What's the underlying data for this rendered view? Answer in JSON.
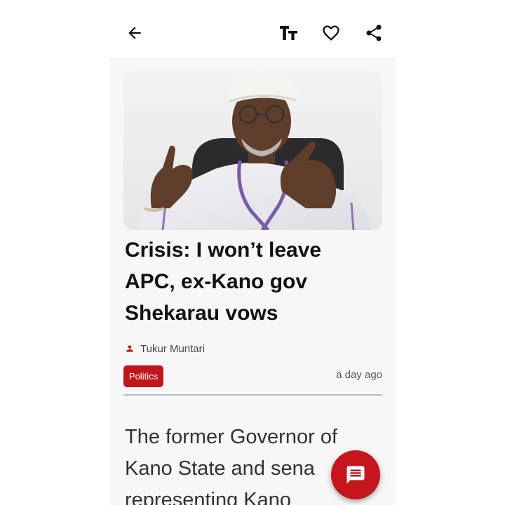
{
  "app_bar": {
    "back_icon": "arrow-left-icon",
    "text_size_icon": "text-size-icon",
    "favorite_icon": "heart-outline-icon",
    "share_icon": "share-icon"
  },
  "article": {
    "hero_image_alt": "",
    "headline": "Crisis: I won’t leave APC, ex-Kano gov Shekarau vows",
    "author": "Tukur Muntari",
    "author_icon": "person-icon",
    "category": "Politics",
    "published": "a day ago",
    "body_excerpt": "The former Governor of Kano State and sena representing Kano"
  },
  "fab": {
    "icon": "comment-icon"
  },
  "colors": {
    "accent": "#c0151b",
    "headline": "#111111",
    "background": "#f7f7f7"
  }
}
